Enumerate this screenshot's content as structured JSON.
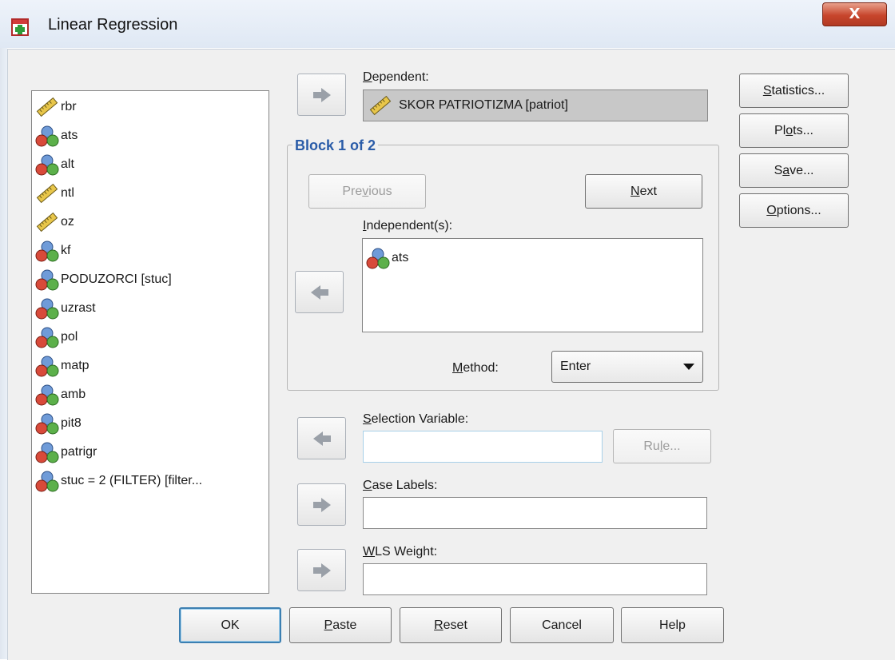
{
  "window": {
    "title": "Linear Regression",
    "close_label": "X"
  },
  "variables": [
    {
      "label": "rbr",
      "icon": "scale-ruler-icon"
    },
    {
      "label": "ats",
      "icon": "nominal-balls-icon"
    },
    {
      "label": "alt",
      "icon": "nominal-balls-icon"
    },
    {
      "label": "ntl",
      "icon": "scale-ruler-icon"
    },
    {
      "label": "oz",
      "icon": "scale-ruler-icon"
    },
    {
      "label": "kf",
      "icon": "nominal-balls-icon"
    },
    {
      "label": "PODUZORCI [stuc]",
      "icon": "nominal-balls-icon"
    },
    {
      "label": "uzrast",
      "icon": "nominal-balls-icon"
    },
    {
      "label": "pol",
      "icon": "nominal-balls-icon"
    },
    {
      "label": "matp",
      "icon": "nominal-balls-icon"
    },
    {
      "label": "amb",
      "icon": "nominal-balls-icon"
    },
    {
      "label": "pit8",
      "icon": "nominal-balls-icon"
    },
    {
      "label": "patrigr",
      "icon": "nominal-balls-icon"
    },
    {
      "label": "stuc = 2 (FILTER) [filter...",
      "icon": "nominal-balls-icon"
    }
  ],
  "dependent": {
    "label_pre": "",
    "label_key": "D",
    "label_post": "ependent:",
    "value": "SKOR PATRIOTIZMA [patriot]"
  },
  "block": {
    "title": "Block 1 of 2",
    "previous_pre": "Pre",
    "previous_key": "v",
    "previous_post": "ious",
    "next_pre": "",
    "next_key": "N",
    "next_post": "ext"
  },
  "independents": {
    "label_pre": "",
    "label_key": "I",
    "label_post": "ndependent(s):",
    "items": [
      {
        "label": "ats",
        "icon": "nominal-balls-icon"
      }
    ]
  },
  "method": {
    "label_pre": "",
    "label_key": "M",
    "label_post": "ethod:",
    "value": "Enter"
  },
  "selection": {
    "label_pre": "",
    "label_key": "S",
    "label_post": "election Variable:",
    "rule_pre": "Ru",
    "rule_key": "l",
    "rule_post": "e..."
  },
  "case_labels": {
    "label_pre": "",
    "label_key": "C",
    "label_post": "ase Labels:"
  },
  "wls": {
    "label_pre": "",
    "label_key": "W",
    "label_post": "LS Weight:"
  },
  "side_buttons": [
    {
      "pre": "",
      "key": "S",
      "post": "tatistics..."
    },
    {
      "pre": "Pl",
      "key": "o",
      "post": "ts..."
    },
    {
      "pre": "S",
      "key": "a",
      "post": "ve..."
    },
    {
      "pre": "",
      "key": "O",
      "post": "ptions..."
    }
  ],
  "bottom_buttons": [
    {
      "pre": "OK",
      "key": "",
      "post": ""
    },
    {
      "pre": "",
      "key": "P",
      "post": "aste"
    },
    {
      "pre": "",
      "key": "R",
      "post": "eset"
    },
    {
      "pre": "Cancel",
      "key": "",
      "post": ""
    },
    {
      "pre": "Help",
      "key": "",
      "post": ""
    }
  ],
  "colors": {
    "block_title": "#2a5ca8",
    "close_button": "#c7452c",
    "dialog_bg": "#f0f0f0"
  }
}
